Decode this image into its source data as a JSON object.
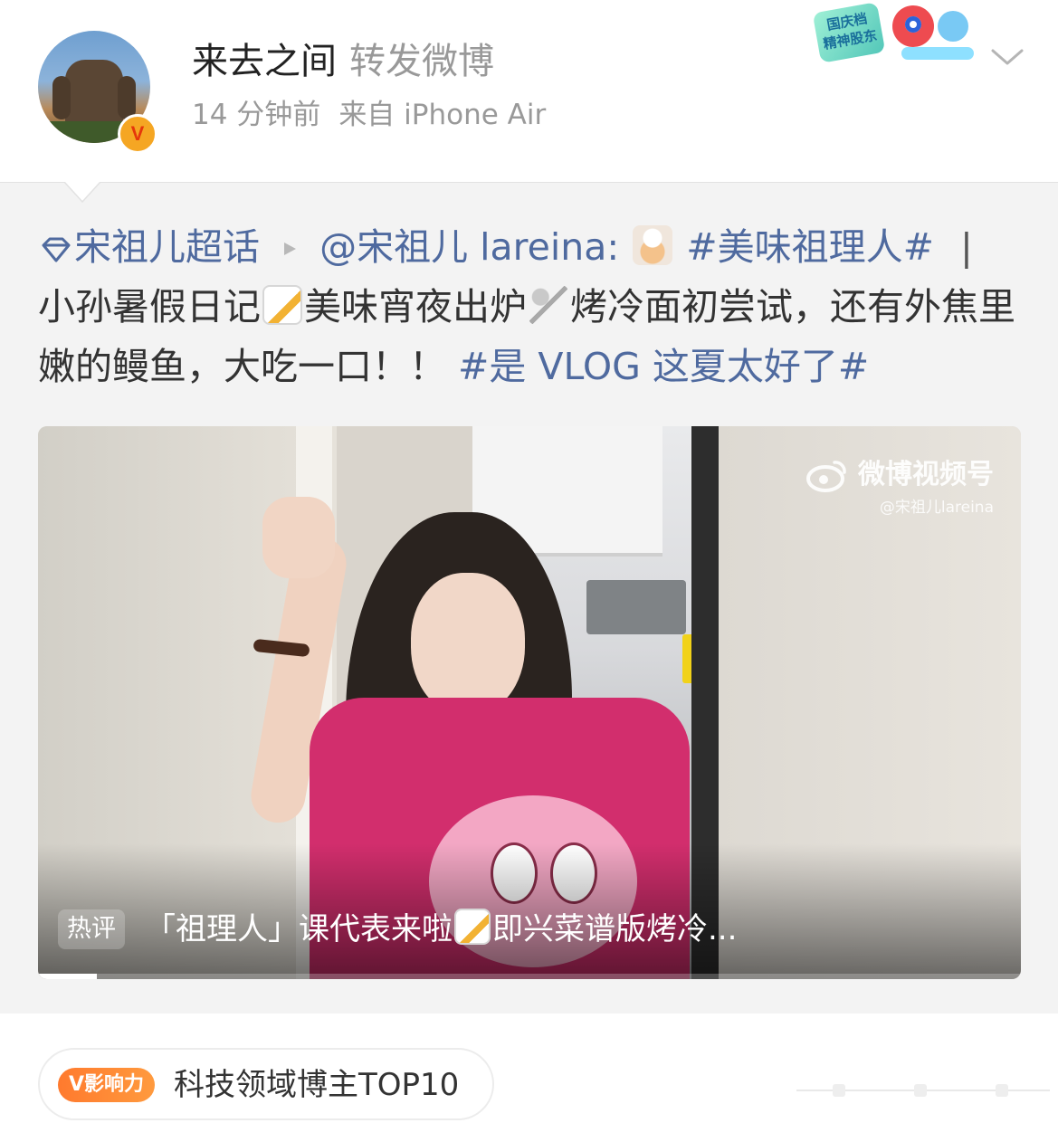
{
  "header": {
    "user_name": "来去之间",
    "repost_label": "转发微博",
    "time": "14 分钟前",
    "source": "来自 iPhone Air",
    "verified_badge": "V",
    "event_badge_text": "国庆档\n精神股东"
  },
  "repost": {
    "topic_link": "宋祖儿超话",
    "author_mention": "@宋祖儿 lareina:",
    "hashtag_1": "#美味祖理人#",
    "separator": "|",
    "text_1": "小孙暑假日记",
    "text_2": "美味宵夜出炉",
    "text_3": "烤冷面初尝试，还有外焦里嫩的鳗鱼，大吃一口！！",
    "hashtag_2": "#是 VLOG 这夏太好了#"
  },
  "video": {
    "watermark_title": "微博视频号",
    "watermark_handle": "@宋祖儿lareina",
    "hot_tag": "热评",
    "caption_1": "「祖理人」课代表来啦",
    "caption_2": "即兴菜谱版烤冷...",
    "progress": 0.06
  },
  "bottom": {
    "influence_tag": "V影响力",
    "influence_text": "科技领域博主TOP10"
  },
  "colors": {
    "link": "#4f6a9f",
    "accent_orange": "#ff7a2e",
    "background": "#f3f3f3"
  }
}
